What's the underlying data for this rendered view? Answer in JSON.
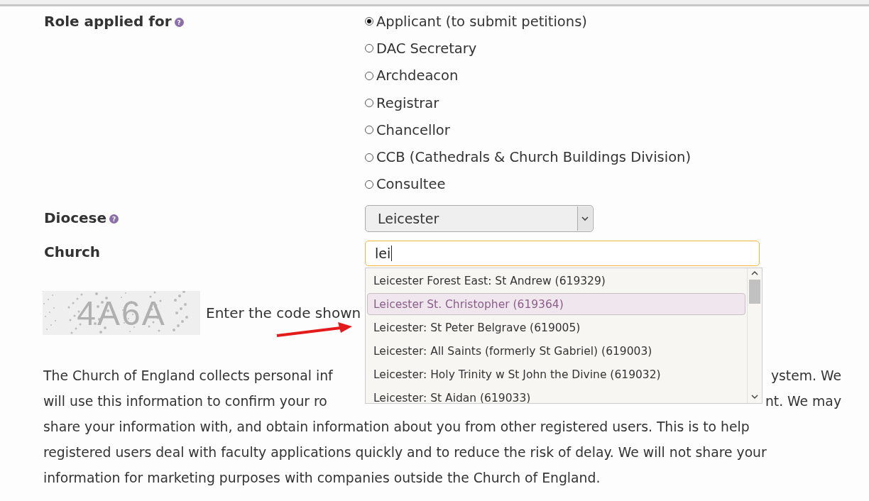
{
  "role": {
    "label": "Role applied for",
    "help": "?",
    "options": [
      {
        "label": "Applicant (to submit petitions)",
        "selected": true
      },
      {
        "label": "DAC Secretary",
        "selected": false
      },
      {
        "label": "Archdeacon",
        "selected": false
      },
      {
        "label": "Registrar",
        "selected": false
      },
      {
        "label": "Chancellor",
        "selected": false
      },
      {
        "label": "CCB (Cathedrals & Church Buildings Division)",
        "selected": false
      },
      {
        "label": "Consultee",
        "selected": false
      }
    ]
  },
  "diocese": {
    "label": "Diocese",
    "help": "?",
    "value": "Leicester"
  },
  "church": {
    "label": "Church",
    "value": "lei",
    "suggestions": [
      {
        "label": "Leicester Forest East: St Andrew (619329)",
        "selected": false
      },
      {
        "label": "Leicester St. Christopher (619364)",
        "selected": true
      },
      {
        "label": "Leicester: St Peter Belgrave (619005)",
        "selected": false
      },
      {
        "label": "Leicester: All Saints (formerly St Gabriel) (619003)",
        "selected": false
      },
      {
        "label": "Leicester: Holy Trinity w St John the Divine (619032)",
        "selected": false
      },
      {
        "label": "Leicester: St Aidan (619033)",
        "selected": false
      }
    ]
  },
  "captcha": {
    "code": "4A6A",
    "prompt": "Enter the code shown"
  },
  "notice": {
    "line_1_start": "The Church of England collects personal inf",
    "line_1_end": "ystem. We",
    "line_2_start": "will use this information to confirm your ro",
    "line_2_end": "nt. We may",
    "lines": [
      "share your information with, and obtain information about you from other registered users. This is to help",
      "registered users deal with faculty applications quickly and to reduce the risk of delay. We will not share your",
      "information for marketing purposes with companies outside the Church of England."
    ]
  }
}
